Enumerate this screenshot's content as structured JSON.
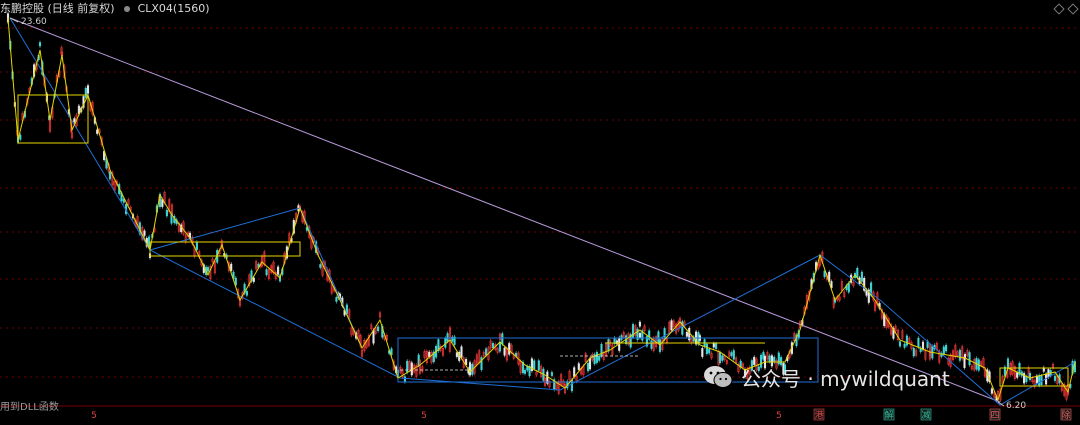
{
  "header": {
    "title": "东鹏控股 (日线 前复权)",
    "indicator": "CLX04(1560)"
  },
  "footer_note": "用到DLL函数",
  "watermark": "公众号 · mywildquant",
  "chart_data": {
    "type": "candlestick",
    "ylim": [
      5.0,
      25.0
    ],
    "high_label": "23.60",
    "low_label": "6.20",
    "marker_labels": [
      "5",
      "5",
      "5",
      "港",
      "解",
      "减",
      "四",
      "除"
    ],
    "colors": {
      "up": "#ff3b3b",
      "down": "#41d6d6",
      "zig": "#e6d600",
      "trend": "#1f6fd6",
      "diag": "#b79ad9",
      "grid": "#6b0000"
    }
  }
}
